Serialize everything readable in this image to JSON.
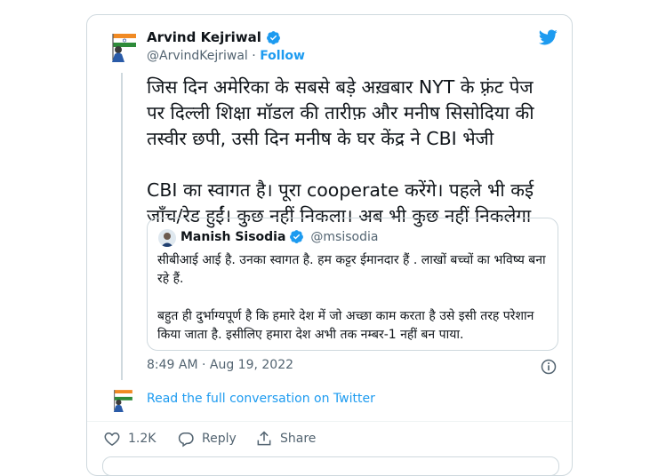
{
  "author": {
    "name": "Arvind Kejriwal",
    "handle": "@ArvindKejriwal",
    "separator": "·",
    "follow_label": "Follow"
  },
  "tweet": {
    "text": "जिस दिन अमेरिका के सबसे बड़े अख़बार NYT के फ़्रंट पेज पर दिल्ली शिक्षा मॉडल की तारीफ़ और मनीष सिसोदिया की तस्वीर छपी, उसी दिन मनीष के घर केंद्र ने CBI भेजी\n\nCBI का स्वागत है। पूरा cooperate करेंगे। पहले भी कई जाँच/रेड हुईं। कुछ नहीं निकला। अब भी कुछ नहीं निकलेगा",
    "timestamp": "8:49 AM · Aug 19, 2022"
  },
  "quoted": {
    "name": "Manish Sisodia",
    "handle": "@msisodia",
    "text": "सीबीआई आई है. उनका स्वागत है. हम कट्टर ईमानदार हैं . लाखों बच्चों का भविष्य बना रहे हैं.\n\nबहुत ही दुर्भाग्यपूर्ण है कि हमारे देश में जो अच्छा काम करता है उसे इसी तरह परेशान किया जाता है. इसीलिए हमारा देश अभी तक नम्बर-1 नहीं बन पाया."
  },
  "read_more": "Read the full conversation on Twitter",
  "actions": {
    "likes": "1.2K",
    "reply": "Reply",
    "share": "Share"
  },
  "icons": {
    "brand": "twitter-bird-icon",
    "verified": "verified-badge-icon",
    "info": "info-icon",
    "like": "heart-icon",
    "reply": "reply-bubble-icon",
    "share": "share-icon"
  },
  "colors": {
    "accent": "#1d9bf0",
    "text": "#0f1419",
    "secondary": "#536471",
    "border": "#cfd9de"
  }
}
